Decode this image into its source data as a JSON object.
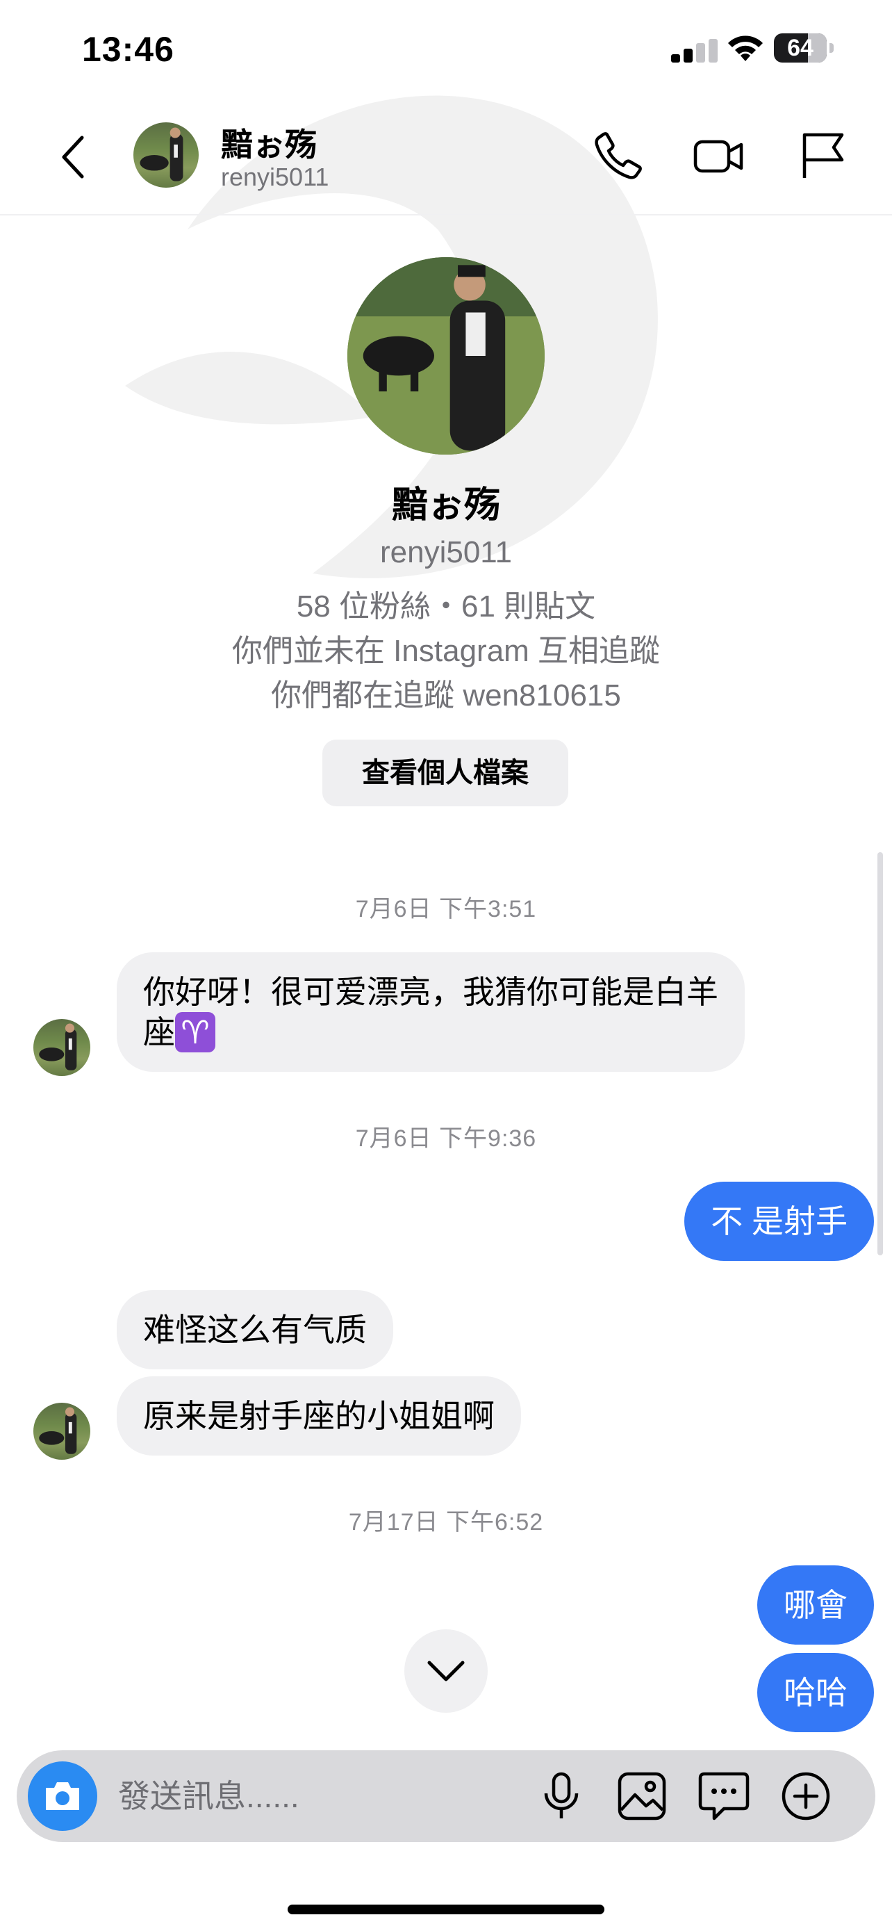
{
  "status_bar": {
    "time": "13:46",
    "battery": "64",
    "battery_level": 0.64
  },
  "header": {
    "back_icon": "chevron-left-icon",
    "name": "黯ぉ殇",
    "username": "renyi5011",
    "actions": [
      "phone-icon",
      "video-camera-icon",
      "flag-icon"
    ]
  },
  "profile": {
    "name": "黯ぉ殇",
    "username": "renyi5011",
    "stats": "58 位粉絲・61 則貼文",
    "mutual_note": "你們並未在 Instagram 互相追蹤",
    "common_follow": "你們都在追蹤 wen810615",
    "view_profile_label": "查看個人檔案"
  },
  "messages": {
    "ts1": "7月6日 下午3:51",
    "m1_text": "你好呀！很可爱漂亮，我猜你可能是白羊座",
    "m1_emoji": "♈",
    "ts2": "7月6日 下午9:36",
    "m2_text": "不 是射手",
    "m3_text": "难怪这么有气质",
    "m4_text": "原来是射手座的小姐姐啊",
    "ts3": "7月17日 下午6:52",
    "m5_text": "哪會",
    "m6_text": "哈哈"
  },
  "composer": {
    "placeholder": "發送訊息......",
    "icons": [
      "camera-icon",
      "microphone-icon",
      "gallery-icon",
      "sticker-icon",
      "plus-icon"
    ]
  },
  "colors": {
    "outgoing_bubble": "#3478f6",
    "incoming_bubble": "#f0f0f2",
    "camera_button": "#2a8bf2",
    "secondary_text": "#737378"
  }
}
